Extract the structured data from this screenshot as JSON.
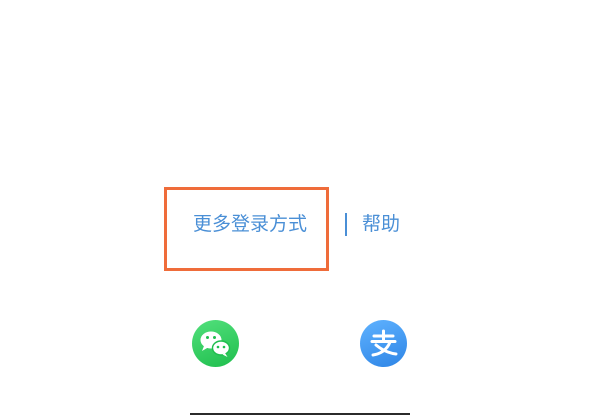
{
  "more_login": {
    "label": "更多登录方式"
  },
  "help": {
    "label": "帮助"
  },
  "colors": {
    "link": "#4a8fd6",
    "highlight": "#ef6c3a",
    "wechat": "#1fbe4d",
    "alipay": "#2e85e6"
  },
  "icons": {
    "wechat": "wechat-icon",
    "alipay": "alipay-icon"
  }
}
